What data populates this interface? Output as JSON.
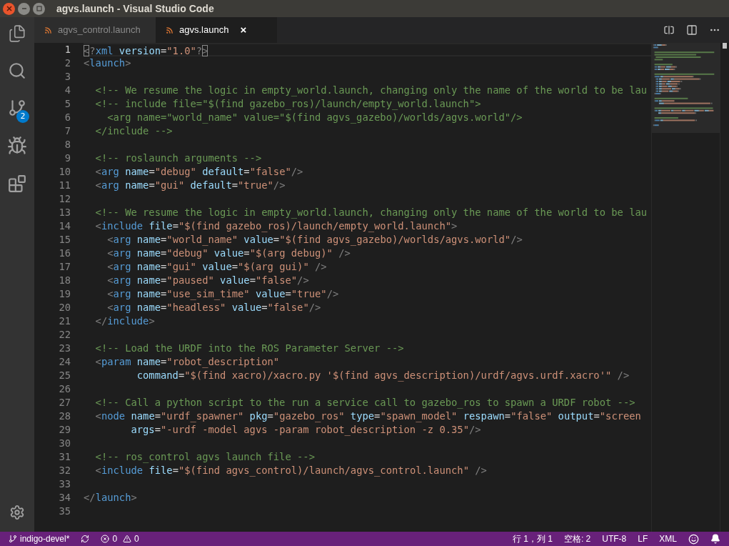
{
  "window": {
    "title": "agvs.launch - Visual Studio Code"
  },
  "activity_bar": {
    "source_control_badge": "2"
  },
  "tabs": [
    {
      "label": "agvs_control.launch",
      "selected": false
    },
    {
      "label": "agvs.launch",
      "selected": true,
      "close": "×"
    }
  ],
  "editor": {
    "lines": [
      {
        "number": "1",
        "current": true,
        "tokens": [
          {
            "kind": "bracket",
            "text": "<"
          },
          {
            "kind": "punct",
            "text": "?"
          },
          {
            "kind": "tag",
            "text": "xml"
          },
          {
            "kind": "attr",
            "text": " version"
          },
          {
            "kind": "plain",
            "text": "="
          },
          {
            "kind": "string",
            "text": "\"1.0\""
          },
          {
            "kind": "punct",
            "text": "?"
          },
          {
            "kind": "bracket",
            "text": ">"
          }
        ]
      },
      {
        "number": "2",
        "current": false,
        "tokens": [
          {
            "kind": "punct",
            "text": "<"
          },
          {
            "kind": "tag",
            "text": "launch"
          },
          {
            "kind": "punct",
            "text": ">"
          }
        ]
      },
      {
        "number": "3",
        "current": false
      },
      {
        "number": "4",
        "current": false,
        "tokens": [
          {
            "kind": "comment",
            "text": "  <!-- We resume the logic in empty_world.launch, changing only the name of the world to be lau"
          }
        ]
      },
      {
        "number": "5",
        "current": false,
        "tokens": [
          {
            "kind": "comment",
            "text": "  <!-- include file=\"$(find gazebo_ros)/launch/empty_world.launch\">"
          }
        ]
      },
      {
        "number": "6",
        "current": false,
        "tokens": [
          {
            "kind": "comment",
            "text": "    <arg name=\"world_name\" value=\"$(find agvs_gazebo)/worlds/agvs.world\"/>"
          }
        ]
      },
      {
        "number": "7",
        "current": false,
        "tokens": [
          {
            "kind": "comment",
            "text": "  </include -->"
          }
        ]
      },
      {
        "number": "8",
        "current": false
      },
      {
        "number": "9",
        "current": false,
        "tokens": [
          {
            "kind": "comment",
            "text": "  <!-- roslaunch arguments -->"
          }
        ]
      },
      {
        "number": "10",
        "current": false,
        "tokens": [
          {
            "kind": "punct",
            "text": "  <"
          },
          {
            "kind": "tag",
            "text": "arg"
          },
          {
            "kind": "attr",
            "text": " name"
          },
          {
            "kind": "plain",
            "text": "="
          },
          {
            "kind": "string",
            "text": "\"debug\""
          },
          {
            "kind": "attr",
            "text": " default"
          },
          {
            "kind": "plain",
            "text": "="
          },
          {
            "kind": "string",
            "text": "\"false\""
          },
          {
            "kind": "punct",
            "text": "/>"
          }
        ]
      },
      {
        "number": "11",
        "current": false,
        "tokens": [
          {
            "kind": "punct",
            "text": "  <"
          },
          {
            "kind": "tag",
            "text": "arg"
          },
          {
            "kind": "attr",
            "text": " name"
          },
          {
            "kind": "plain",
            "text": "="
          },
          {
            "kind": "string",
            "text": "\"gui\""
          },
          {
            "kind": "attr",
            "text": " default"
          },
          {
            "kind": "plain",
            "text": "="
          },
          {
            "kind": "string",
            "text": "\"true\""
          },
          {
            "kind": "punct",
            "text": "/>"
          }
        ]
      },
      {
        "number": "12",
        "current": false
      },
      {
        "number": "13",
        "current": false,
        "tokens": [
          {
            "kind": "comment",
            "text": "  <!-- We resume the logic in empty_world.launch, changing only the name of the world to be lau"
          }
        ]
      },
      {
        "number": "14",
        "current": false,
        "tokens": [
          {
            "kind": "punct",
            "text": "  <"
          },
          {
            "kind": "tag",
            "text": "include"
          },
          {
            "kind": "attr",
            "text": " file"
          },
          {
            "kind": "plain",
            "text": "="
          },
          {
            "kind": "string",
            "text": "\"$(find gazebo_ros)/launch/empty_world.launch\""
          },
          {
            "kind": "punct",
            "text": ">"
          }
        ]
      },
      {
        "number": "15",
        "current": false,
        "tokens": [
          {
            "kind": "punct",
            "text": "    <"
          },
          {
            "kind": "tag",
            "text": "arg"
          },
          {
            "kind": "attr",
            "text": " name"
          },
          {
            "kind": "plain",
            "text": "="
          },
          {
            "kind": "string",
            "text": "\"world_name\""
          },
          {
            "kind": "attr",
            "text": " value"
          },
          {
            "kind": "plain",
            "text": "="
          },
          {
            "kind": "string",
            "text": "\"$(find agvs_gazebo)/worlds/agvs.world\""
          },
          {
            "kind": "punct",
            "text": "/>"
          }
        ]
      },
      {
        "number": "16",
        "current": false,
        "tokens": [
          {
            "kind": "punct",
            "text": "    <"
          },
          {
            "kind": "tag",
            "text": "arg"
          },
          {
            "kind": "attr",
            "text": " name"
          },
          {
            "kind": "plain",
            "text": "="
          },
          {
            "kind": "string",
            "text": "\"debug\""
          },
          {
            "kind": "attr",
            "text": " value"
          },
          {
            "kind": "plain",
            "text": "="
          },
          {
            "kind": "string",
            "text": "\"$(arg debug)\""
          },
          {
            "kind": "punct",
            "text": " />"
          }
        ]
      },
      {
        "number": "17",
        "current": false,
        "tokens": [
          {
            "kind": "punct",
            "text": "    <"
          },
          {
            "kind": "tag",
            "text": "arg"
          },
          {
            "kind": "attr",
            "text": " name"
          },
          {
            "kind": "plain",
            "text": "="
          },
          {
            "kind": "string",
            "text": "\"gui\""
          },
          {
            "kind": "attr",
            "text": " value"
          },
          {
            "kind": "plain",
            "text": "="
          },
          {
            "kind": "string",
            "text": "\"$(arg gui)\""
          },
          {
            "kind": "punct",
            "text": " />"
          }
        ]
      },
      {
        "number": "18",
        "current": false,
        "tokens": [
          {
            "kind": "punct",
            "text": "    <"
          },
          {
            "kind": "tag",
            "text": "arg"
          },
          {
            "kind": "attr",
            "text": " name"
          },
          {
            "kind": "plain",
            "text": "="
          },
          {
            "kind": "string",
            "text": "\"paused\""
          },
          {
            "kind": "attr",
            "text": " value"
          },
          {
            "kind": "plain",
            "text": "="
          },
          {
            "kind": "string",
            "text": "\"false\""
          },
          {
            "kind": "punct",
            "text": "/>"
          }
        ]
      },
      {
        "number": "19",
        "current": false,
        "tokens": [
          {
            "kind": "punct",
            "text": "    <"
          },
          {
            "kind": "tag",
            "text": "arg"
          },
          {
            "kind": "attr",
            "text": " name"
          },
          {
            "kind": "plain",
            "text": "="
          },
          {
            "kind": "string",
            "text": "\"use_sim_time\""
          },
          {
            "kind": "attr",
            "text": " value"
          },
          {
            "kind": "plain",
            "text": "="
          },
          {
            "kind": "string",
            "text": "\"true\""
          },
          {
            "kind": "punct",
            "text": "/>"
          }
        ]
      },
      {
        "number": "20",
        "current": false,
        "tokens": [
          {
            "kind": "punct",
            "text": "    <"
          },
          {
            "kind": "tag",
            "text": "arg"
          },
          {
            "kind": "attr",
            "text": " name"
          },
          {
            "kind": "plain",
            "text": "="
          },
          {
            "kind": "string",
            "text": "\"headless\""
          },
          {
            "kind": "attr",
            "text": " value"
          },
          {
            "kind": "plain",
            "text": "="
          },
          {
            "kind": "string",
            "text": "\"false\""
          },
          {
            "kind": "punct",
            "text": "/>"
          }
        ]
      },
      {
        "number": "21",
        "current": false,
        "tokens": [
          {
            "kind": "punct",
            "text": "  </"
          },
          {
            "kind": "tag",
            "text": "include"
          },
          {
            "kind": "punct",
            "text": ">"
          }
        ]
      },
      {
        "number": "22",
        "current": false
      },
      {
        "number": "23",
        "current": false,
        "tokens": [
          {
            "kind": "comment",
            "text": "  <!-- Load the URDF into the ROS Parameter Server -->"
          }
        ]
      },
      {
        "number": "24",
        "current": false,
        "tokens": [
          {
            "kind": "punct",
            "text": "  <"
          },
          {
            "kind": "tag",
            "text": "param"
          },
          {
            "kind": "attr",
            "text": " name"
          },
          {
            "kind": "plain",
            "text": "="
          },
          {
            "kind": "string",
            "text": "\"robot_description\""
          }
        ]
      },
      {
        "number": "25",
        "current": false,
        "tokens": [
          {
            "kind": "attr",
            "text": "         command"
          },
          {
            "kind": "plain",
            "text": "="
          },
          {
            "kind": "string",
            "text": "\"$(find xacro)/xacro.py '$(find agvs_description)/urdf/agvs.urdf.xacro'\""
          },
          {
            "kind": "punct",
            "text": " />"
          }
        ]
      },
      {
        "number": "26",
        "current": false
      },
      {
        "number": "27",
        "current": false,
        "tokens": [
          {
            "kind": "comment",
            "text": "  <!-- Call a python script to the run a service call to gazebo_ros to spawn a URDF robot -->"
          }
        ]
      },
      {
        "number": "28",
        "current": false,
        "tokens": [
          {
            "kind": "punct",
            "text": "  <"
          },
          {
            "kind": "tag",
            "text": "node"
          },
          {
            "kind": "attr",
            "text": " name"
          },
          {
            "kind": "plain",
            "text": "="
          },
          {
            "kind": "string",
            "text": "\"urdf_spawner\""
          },
          {
            "kind": "attr",
            "text": " pkg"
          },
          {
            "kind": "plain",
            "text": "="
          },
          {
            "kind": "string",
            "text": "\"gazebo_ros\""
          },
          {
            "kind": "attr",
            "text": " type"
          },
          {
            "kind": "plain",
            "text": "="
          },
          {
            "kind": "string",
            "text": "\"spawn_model\""
          },
          {
            "kind": "attr",
            "text": " respawn"
          },
          {
            "kind": "plain",
            "text": "="
          },
          {
            "kind": "string",
            "text": "\"false\""
          },
          {
            "kind": "attr",
            "text": " output"
          },
          {
            "kind": "plain",
            "text": "="
          },
          {
            "kind": "string",
            "text": "\"screen"
          }
        ]
      },
      {
        "number": "29",
        "current": false,
        "tokens": [
          {
            "kind": "attr",
            "text": "        args"
          },
          {
            "kind": "plain",
            "text": "="
          },
          {
            "kind": "string",
            "text": "\"-urdf -model agvs -param robot_description -z 0.35\""
          },
          {
            "kind": "punct",
            "text": "/>"
          }
        ]
      },
      {
        "number": "30",
        "current": false
      },
      {
        "number": "31",
        "current": false,
        "tokens": [
          {
            "kind": "comment",
            "text": "  <!-- ros_control agvs launch file -->"
          }
        ]
      },
      {
        "number": "32",
        "current": false,
        "tokens": [
          {
            "kind": "punct",
            "text": "  <"
          },
          {
            "kind": "tag",
            "text": "include"
          },
          {
            "kind": "attr",
            "text": " file"
          },
          {
            "kind": "plain",
            "text": "="
          },
          {
            "kind": "string",
            "text": "\"$(find agvs_control)/launch/agvs_control.launch\""
          },
          {
            "kind": "punct",
            "text": " />"
          }
        ]
      },
      {
        "number": "33",
        "current": false
      },
      {
        "number": "34",
        "current": false,
        "tokens": [
          {
            "kind": "punct",
            "text": "</"
          },
          {
            "kind": "tag",
            "text": "launch"
          },
          {
            "kind": "punct",
            "text": ">"
          }
        ]
      },
      {
        "number": "35",
        "current": false
      }
    ]
  },
  "status_bar": {
    "branch": "indigo-devel*",
    "errors": "0",
    "warnings": "0",
    "position": "行 1，列 1",
    "indentation": "空格: 2",
    "encoding": "UTF-8",
    "line_ending": "LF",
    "language": "XML"
  }
}
